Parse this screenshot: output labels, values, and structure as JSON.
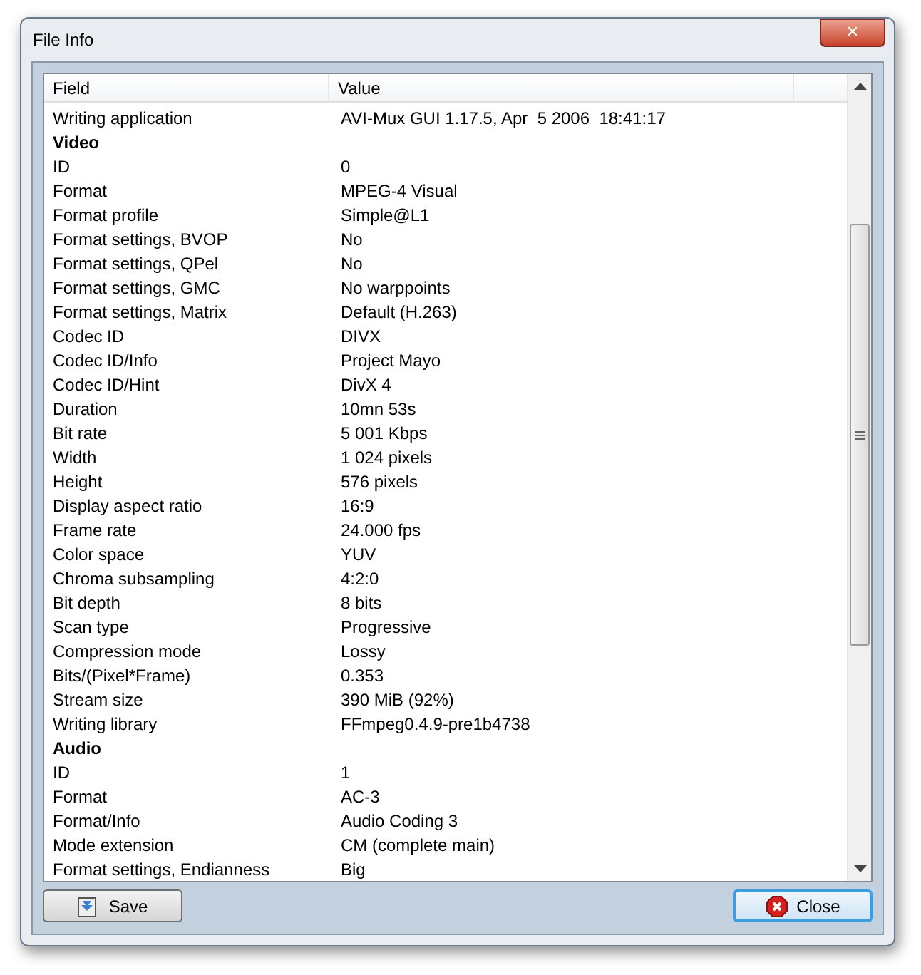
{
  "window": {
    "title": "File Info",
    "close_glyph": "✕"
  },
  "table": {
    "columns": [
      "Field",
      "Value"
    ],
    "rows": [
      {
        "kind": "field",
        "field": "Writing application",
        "value": "AVI-Mux GUI 1.17.5, Apr  5 2006  18:41:17"
      },
      {
        "kind": "section",
        "field": "Video"
      },
      {
        "kind": "field",
        "field": "ID",
        "value": "0"
      },
      {
        "kind": "field",
        "field": "Format",
        "value": "MPEG-4 Visual"
      },
      {
        "kind": "field",
        "field": "Format profile",
        "value": "Simple@L1"
      },
      {
        "kind": "field",
        "field": "Format settings, BVOP",
        "value": "No"
      },
      {
        "kind": "field",
        "field": "Format settings, QPel",
        "value": "No"
      },
      {
        "kind": "field",
        "field": "Format settings, GMC",
        "value": "No warppoints"
      },
      {
        "kind": "field",
        "field": "Format settings, Matrix",
        "value": "Default (H.263)"
      },
      {
        "kind": "field",
        "field": "Codec ID",
        "value": "DIVX"
      },
      {
        "kind": "field",
        "field": "Codec ID/Info",
        "value": "Project Mayo"
      },
      {
        "kind": "field",
        "field": "Codec ID/Hint",
        "value": "DivX 4"
      },
      {
        "kind": "field",
        "field": "Duration",
        "value": "10mn 53s"
      },
      {
        "kind": "field",
        "field": "Bit rate",
        "value": "5 001 Kbps"
      },
      {
        "kind": "field",
        "field": "Width",
        "value": "1 024 pixels"
      },
      {
        "kind": "field",
        "field": "Height",
        "value": "576 pixels"
      },
      {
        "kind": "field",
        "field": "Display aspect ratio",
        "value": "16:9"
      },
      {
        "kind": "field",
        "field": "Frame rate",
        "value": "24.000 fps"
      },
      {
        "kind": "field",
        "field": "Color space",
        "value": "YUV"
      },
      {
        "kind": "field",
        "field": "Chroma subsampling",
        "value": "4:2:0"
      },
      {
        "kind": "field",
        "field": "Bit depth",
        "value": "8 bits"
      },
      {
        "kind": "field",
        "field": "Scan type",
        "value": "Progressive"
      },
      {
        "kind": "field",
        "field": "Compression mode",
        "value": "Lossy"
      },
      {
        "kind": "field",
        "field": "Bits/(Pixel*Frame)",
        "value": "0.353"
      },
      {
        "kind": "field",
        "field": "Stream size",
        "value": "390 MiB (92%)"
      },
      {
        "kind": "field",
        "field": "Writing library",
        "value": "FFmpeg0.4.9-pre1b4738"
      },
      {
        "kind": "section",
        "field": "Audio"
      },
      {
        "kind": "field",
        "field": "ID",
        "value": "1"
      },
      {
        "kind": "field",
        "field": "Format",
        "value": "AC-3"
      },
      {
        "kind": "field",
        "field": "Format/Info",
        "value": "Audio Coding 3"
      },
      {
        "kind": "field",
        "field": "Mode extension",
        "value": "CM (complete main)"
      },
      {
        "kind": "field",
        "field": "Format settings, Endianness",
        "value": "Big"
      }
    ]
  },
  "buttons": {
    "save": "Save",
    "close": "Close"
  }
}
